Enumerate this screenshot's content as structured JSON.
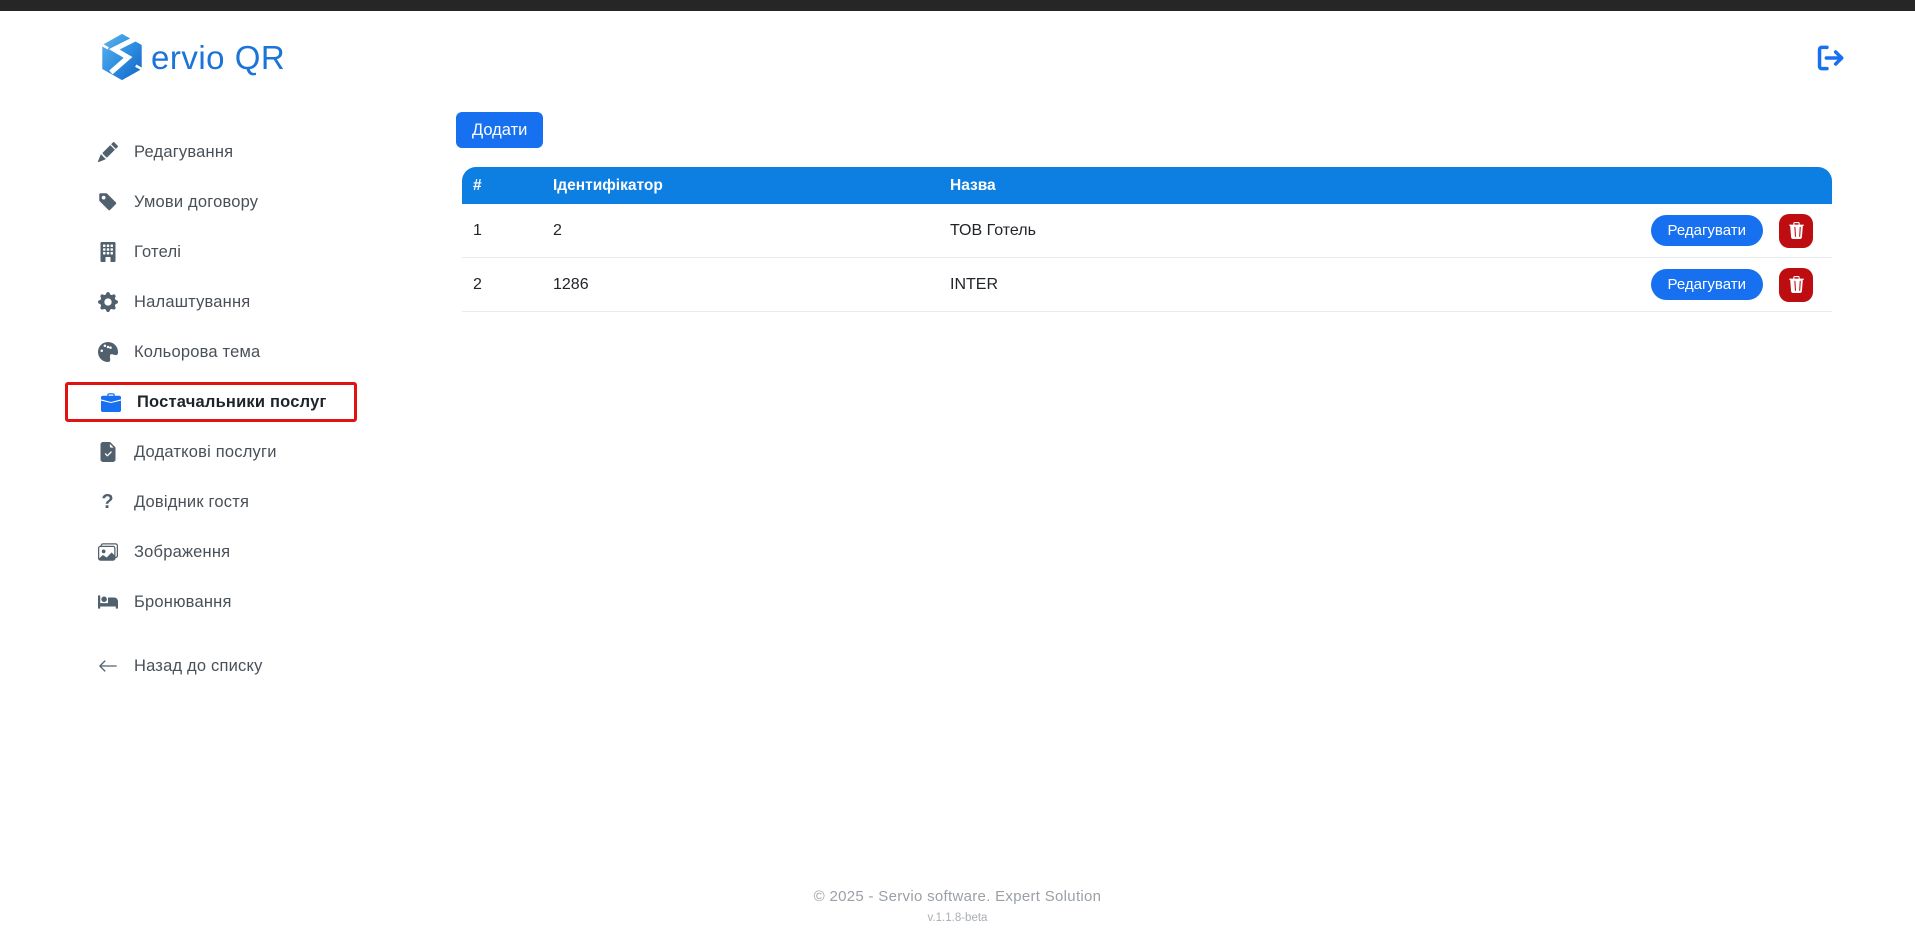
{
  "brand": {
    "logo_text": "ervio QR"
  },
  "sidebar": {
    "items": [
      {
        "label": "Редагування",
        "icon": "pencil-icon"
      },
      {
        "label": "Умови договору",
        "icon": "tag-icon"
      },
      {
        "label": "Готелі",
        "icon": "hotel-icon"
      },
      {
        "label": "Налаштування",
        "icon": "gear-icon"
      },
      {
        "label": "Кольорова тема",
        "icon": "palette-icon"
      },
      {
        "label": "Постачальники послуг",
        "icon": "briefcase-icon",
        "active": true,
        "highlighted": true
      },
      {
        "label": "Додаткові послуги",
        "icon": "document-check-icon"
      },
      {
        "label": "Довідник гостя",
        "icon": "question-icon"
      },
      {
        "label": "Зображення",
        "icon": "images-icon"
      },
      {
        "label": "Бронювання",
        "icon": "bed-icon"
      }
    ],
    "back_label": "Назад до списку"
  },
  "main": {
    "add_button_label": "Додати",
    "table": {
      "headers": {
        "num": "#",
        "identifier": "Ідентифікатор",
        "name": "Назва"
      },
      "rows": [
        {
          "num": "1",
          "identifier": "2",
          "name": "ТОВ Готель"
        },
        {
          "num": "2",
          "identifier": "1286",
          "name": "INTER"
        }
      ],
      "edit_label": "Редагувати"
    }
  },
  "footer": {
    "copyright": "© 2025 - Servio software. Expert Solution",
    "version": "v.1.1.8-beta"
  },
  "colors": {
    "table_header_blue": "#0d7ee2",
    "button_blue": "#1670f0",
    "danger_red": "#bd0d10",
    "highlight_red": "#e01212",
    "brand_blue": "#1b74d8",
    "sidebar_icon_gray": "#51606d"
  }
}
